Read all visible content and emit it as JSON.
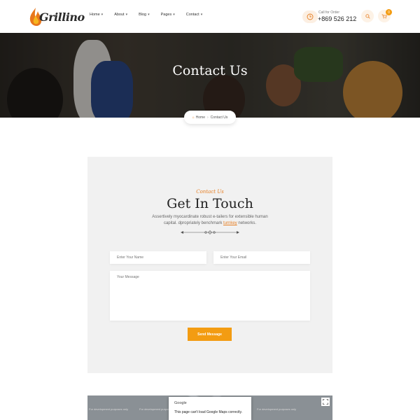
{
  "header": {
    "logo_text": "Grillino",
    "nav": [
      {
        "label": "Home"
      },
      {
        "label": "About"
      },
      {
        "label": "Blog"
      },
      {
        "label": "Pages"
      },
      {
        "label": "Contact"
      }
    ],
    "call_label": "Call for Order",
    "call_number": "+869 526 212",
    "cart_count": "0",
    "icons": {
      "phone": "phone-icon",
      "search": "search-icon",
      "cart": "cart-icon"
    },
    "accent_color": "#f39c12"
  },
  "hero": {
    "title": "Contact Us",
    "breadcrumb": {
      "home": "Home",
      "current": "Contact Us"
    }
  },
  "contact": {
    "subtitle": "Contact Us",
    "title": "Get In Touch",
    "description_before": "Assertively myocardinate robust e-tailers for extensible human capital. dpropriately benchmark ",
    "description_highlight": "turnkey",
    "description_after": " networks.",
    "fields": {
      "name_placeholder": "Enter Your Name",
      "email_placeholder": "Enter Your Email",
      "message_placeholder": "Your Message"
    },
    "send_label": "Send Message"
  },
  "map": {
    "note": "For development purposes only",
    "popup_brand": "Google",
    "popup_message": "This page can't load Google Maps correctly."
  }
}
